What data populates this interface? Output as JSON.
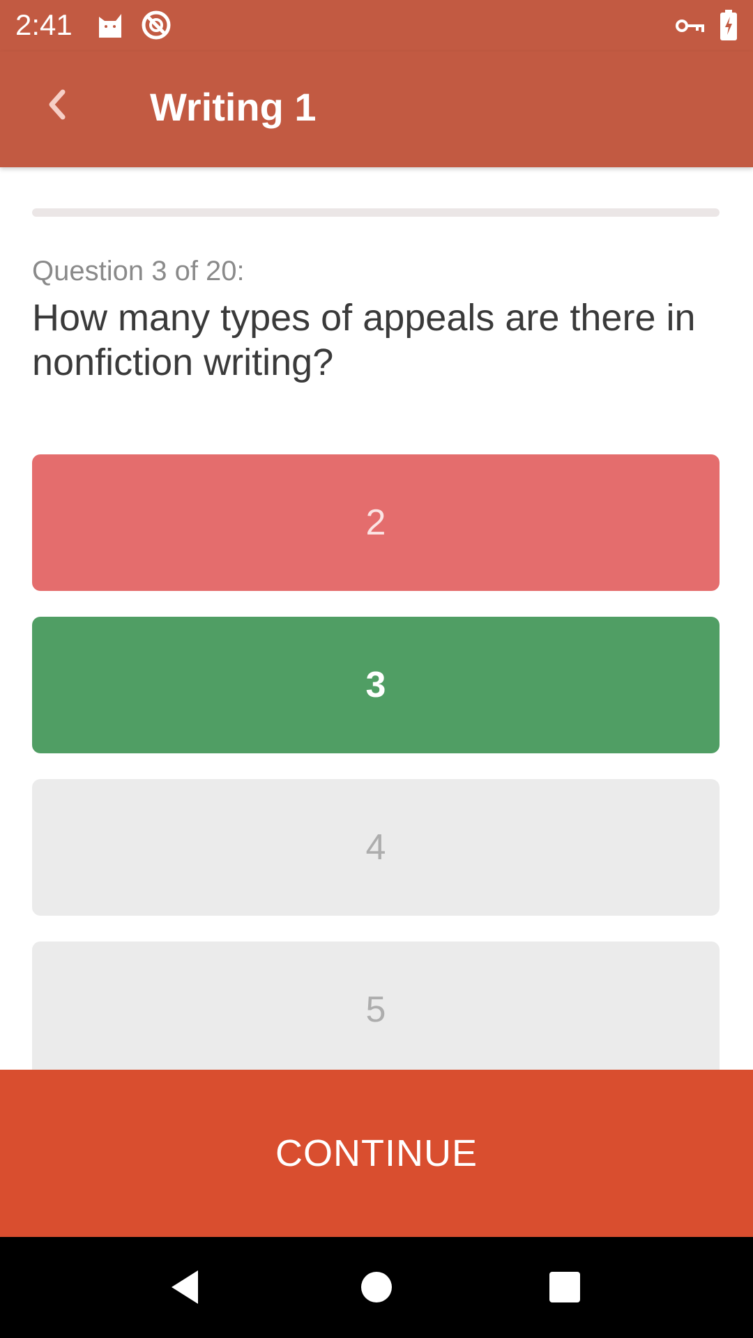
{
  "status_bar": {
    "time": "2:41",
    "left_icons": [
      "cat-icon",
      "do-not-disturb-icon"
    ],
    "right_icons": [
      "vpn-key-icon",
      "battery-charging-icon"
    ]
  },
  "app_bar": {
    "title": "Writing 1",
    "back_icon": "chevron-left-icon"
  },
  "quiz": {
    "progress": {
      "current": 3,
      "total": 20
    },
    "counter": "Question 3 of 20:",
    "question": "How many types of appeals are there in nonfiction writing?",
    "answers": [
      {
        "label": "2",
        "state": "wrong"
      },
      {
        "label": "3",
        "state": "correct"
      },
      {
        "label": "4",
        "state": "neutral"
      },
      {
        "label": "5",
        "state": "neutral"
      }
    ]
  },
  "continue_label": "CONTINUE",
  "nav_bar": {
    "buttons": [
      "back-triangle-icon",
      "home-circle-icon",
      "recents-square-icon"
    ]
  },
  "colors": {
    "header": "#c25a42",
    "continue": "#d94e2f",
    "wrong": "#e46d6d",
    "correct": "#509e64",
    "neutral": "#ebebeb"
  }
}
